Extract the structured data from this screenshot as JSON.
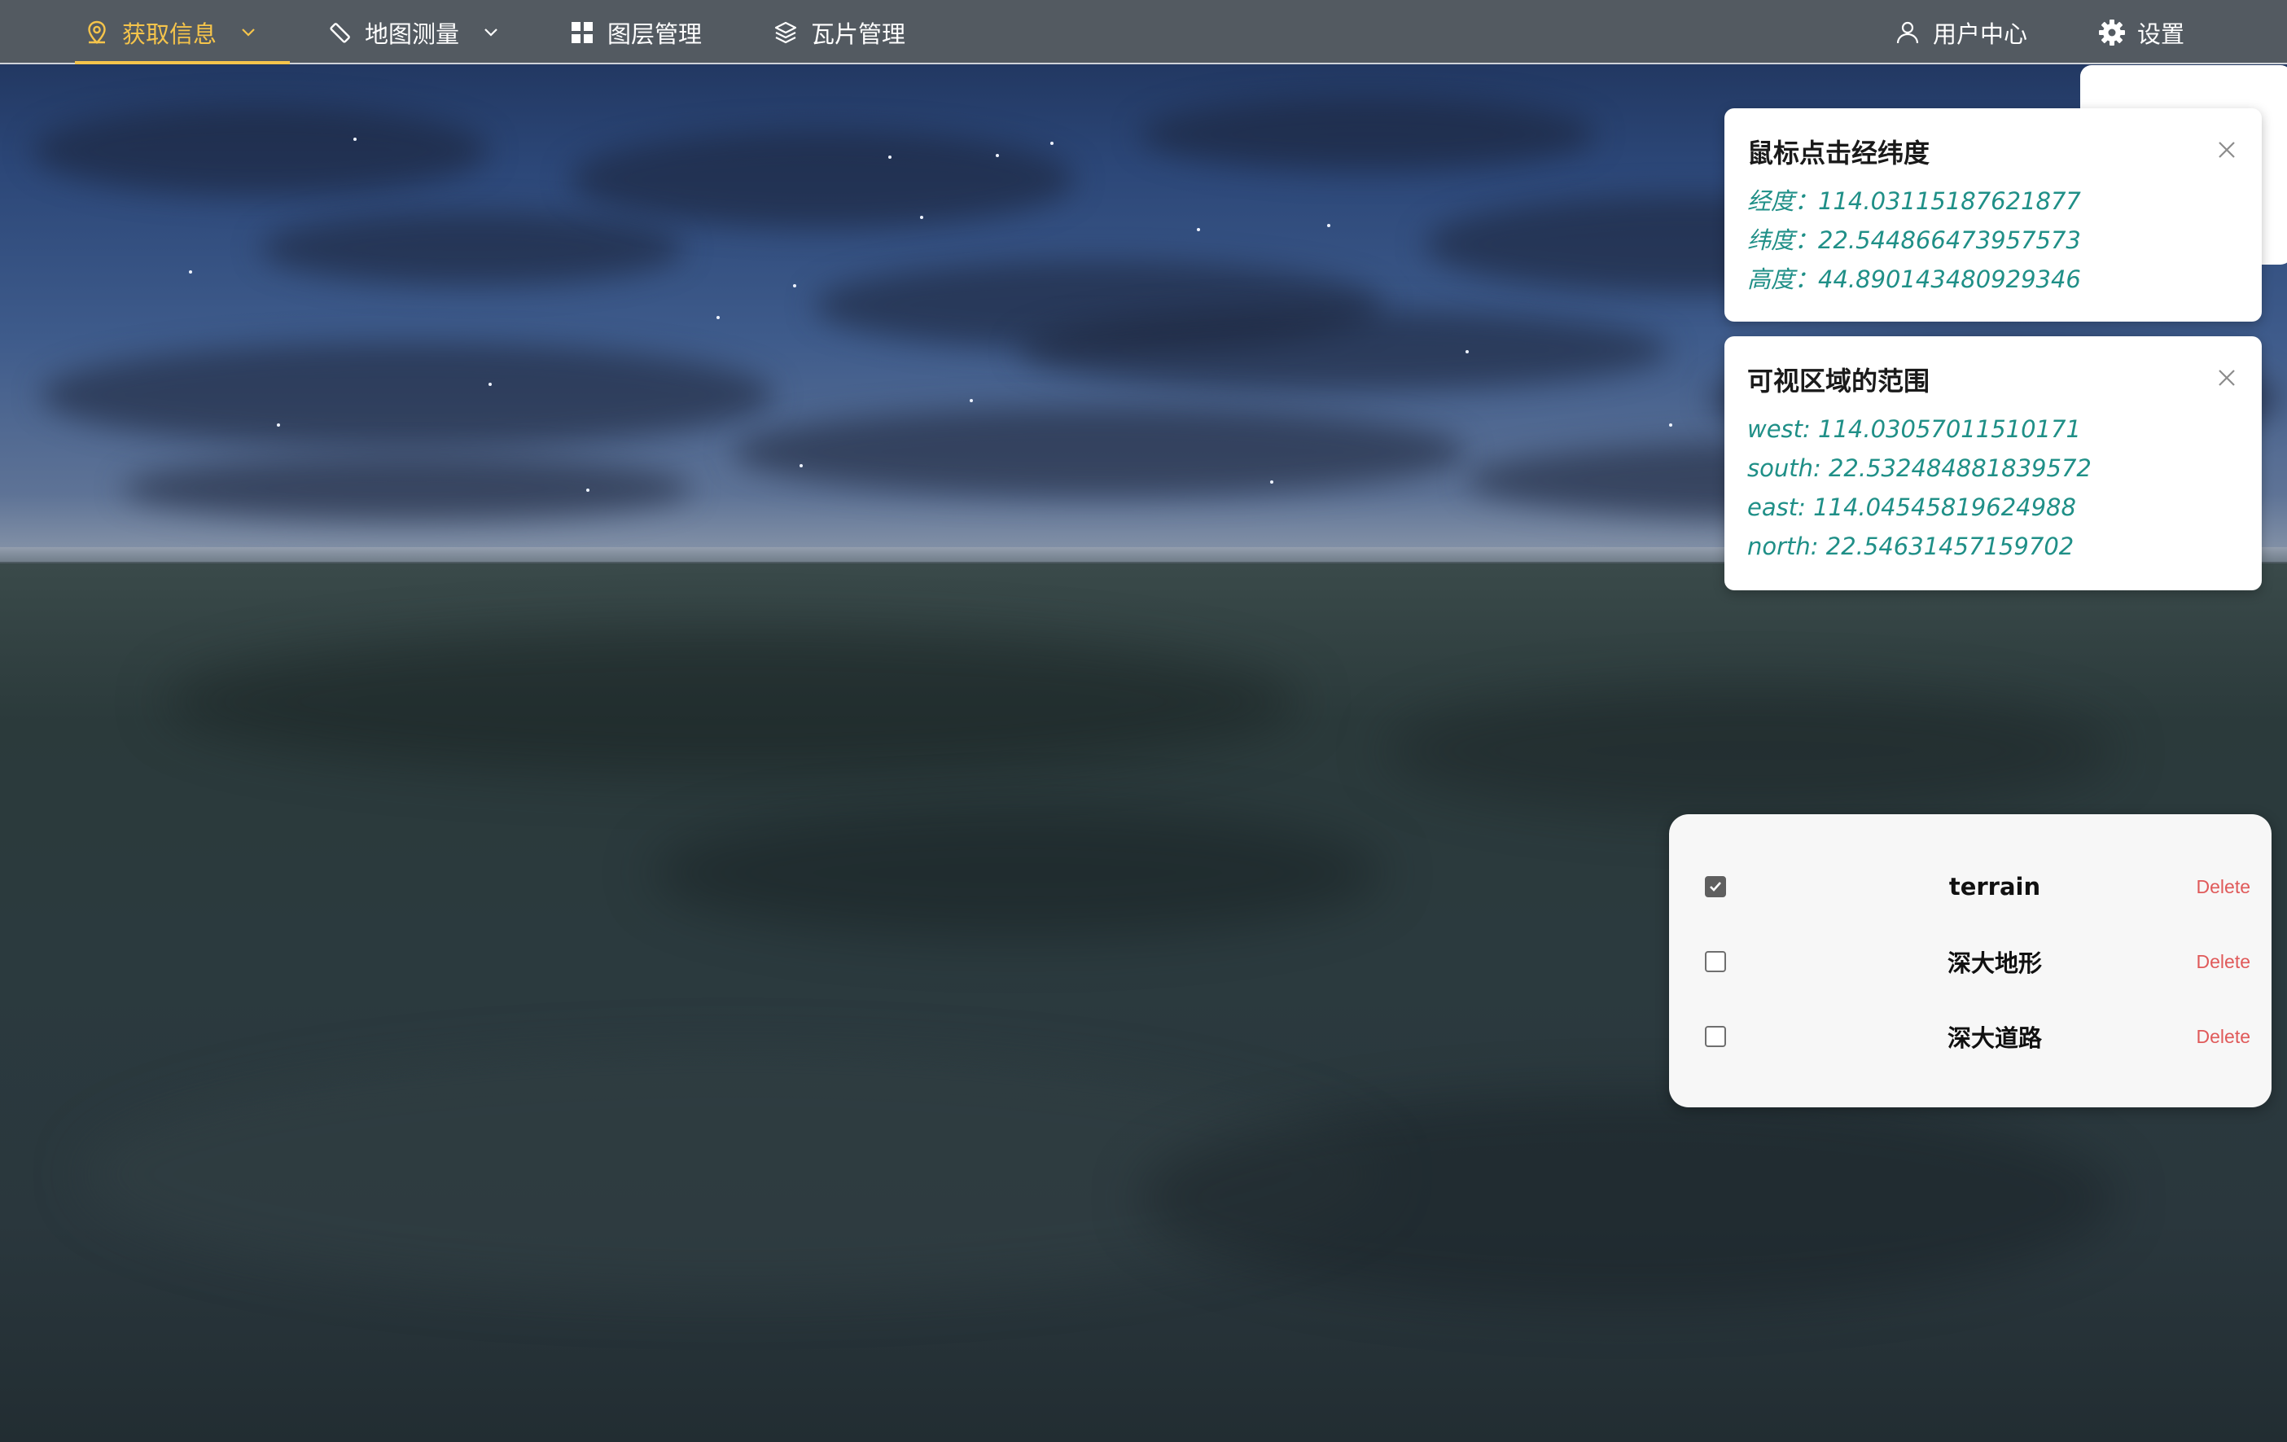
{
  "nav": {
    "items": [
      {
        "label": "获取信息",
        "icon": "location-pin-icon",
        "has_dropdown": true,
        "active": true
      },
      {
        "label": "地图测量",
        "icon": "ruler-icon",
        "has_dropdown": true,
        "active": false
      },
      {
        "label": "图层管理",
        "icon": "grid-icon",
        "has_dropdown": false,
        "active": false
      },
      {
        "label": "瓦片管理",
        "icon": "layers-icon",
        "has_dropdown": false,
        "active": false
      }
    ],
    "right": [
      {
        "label": "用户中心",
        "icon": "user-icon"
      },
      {
        "label": "设置",
        "icon": "gear-icon"
      }
    ]
  },
  "click_info": {
    "title": "鼠标点击经纬度",
    "longitude": "经度：114.03115187621877",
    "latitude": "纬度：22.544866473957573",
    "height": "高度：44.890143480929346"
  },
  "view_extent": {
    "title": "可视区域的范围",
    "west": "west: 114.03057011510171",
    "south": "south: 22.532484881839572",
    "east": "east: 114.04545819624988",
    "north": "north: 22.54631457159702"
  },
  "layers": {
    "items": [
      {
        "name": "terrain",
        "checked": true,
        "delete_label": "Delete"
      },
      {
        "name": "深大地形",
        "checked": false,
        "delete_label": "Delete"
      },
      {
        "name": "深大道路",
        "checked": false,
        "delete_label": "Delete"
      }
    ]
  },
  "colors": {
    "accent": "#f5c44b",
    "topbar": "#535a61",
    "info_text": "#1f8f87",
    "delete": "#e05a5a"
  }
}
